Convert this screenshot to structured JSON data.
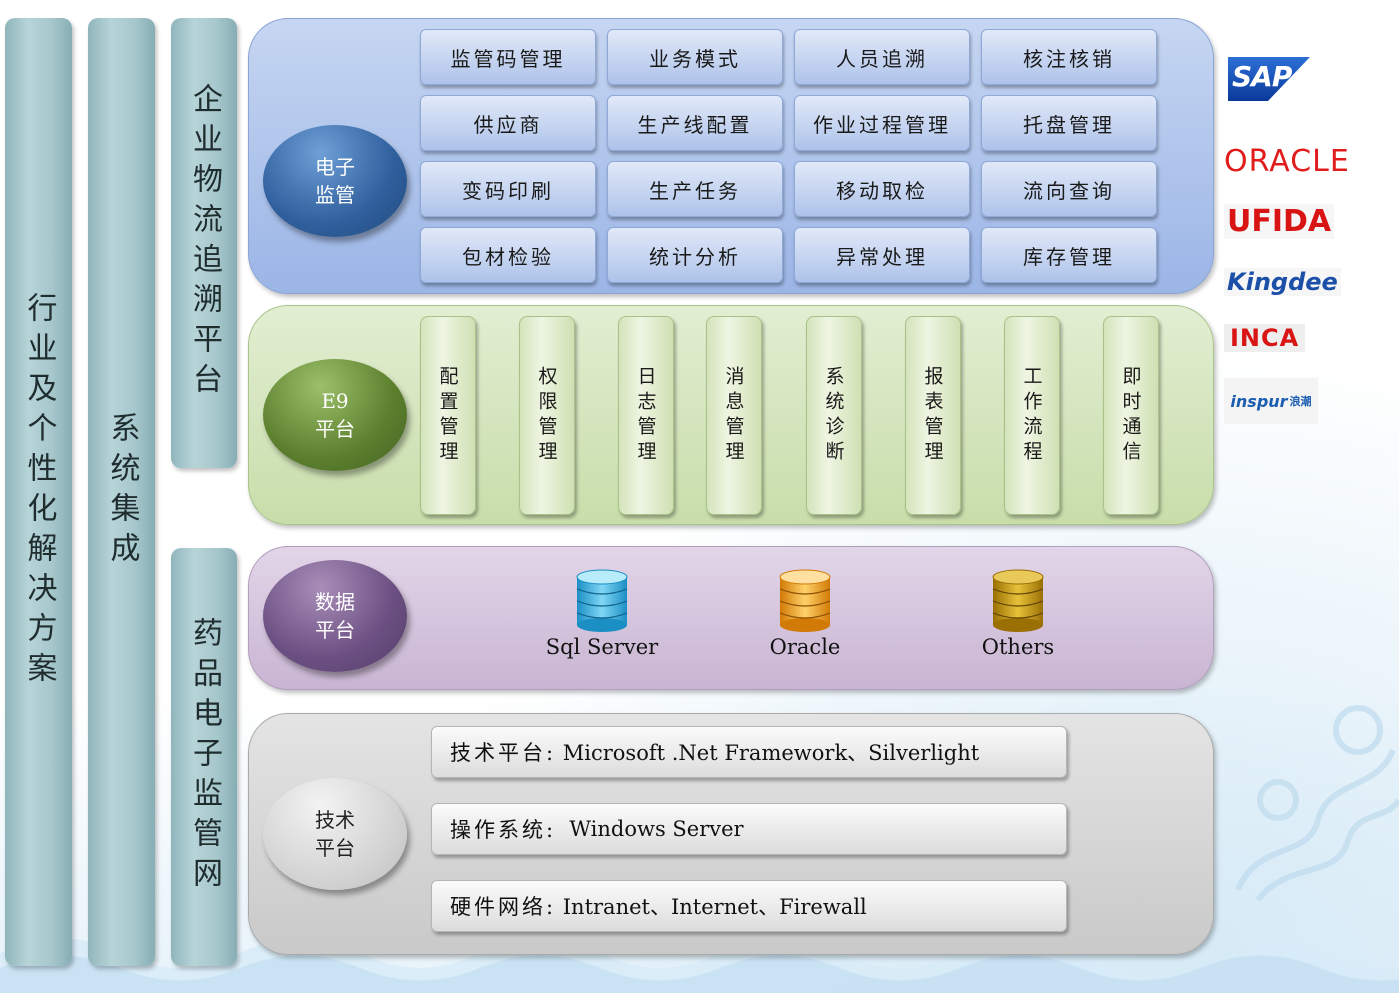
{
  "columns": {
    "industry": "行业及个性化解决方案",
    "integration": "系统集成",
    "enterprise_platform": "企业物流追溯平台",
    "drug_network": "药品电子监管网"
  },
  "layers": {
    "e_supervision": {
      "title": "电子\n监管",
      "modules": [
        "监管码管理",
        "业务模式",
        "人员追溯",
        "核注核销",
        "供应商",
        "生产线配置",
        "作业过程管理",
        "托盘管理",
        "变码印刷",
        "生产任务",
        "移动取检",
        "流向查询",
        "包材检验",
        "统计分析",
        "异常处理",
        "库存管理"
      ]
    },
    "e9_platform": {
      "title": "E9\n平台",
      "modules": [
        "配置管理",
        "权限管理",
        "日志管理",
        "消息管理",
        "系统诊断",
        "报表管理",
        "工作流程",
        "即时通信"
      ]
    },
    "data_platform": {
      "title": "数据\n平台",
      "databases": [
        {
          "label": "Sql Server",
          "color": "#3fb6e6"
        },
        {
          "label": "Oracle",
          "color": "#f0a020"
        },
        {
          "label": "Others",
          "color": "#c9960c"
        }
      ]
    },
    "tech_platform": {
      "title": "技术\n平台",
      "rows": [
        {
          "label": "技术平台:",
          "value": " Microsoft .Net Framework、Silverlight"
        },
        {
          "label": "操作系统:",
          "value": "  Windows Server"
        },
        {
          "label": "硬件网络:",
          "value": " Intranet、Internet、Firewall"
        }
      ]
    }
  },
  "vendors": [
    "SAP",
    "ORACLE",
    "UFIDA",
    "Kingdee",
    "INCA",
    "inspur",
    "浪潮"
  ]
}
